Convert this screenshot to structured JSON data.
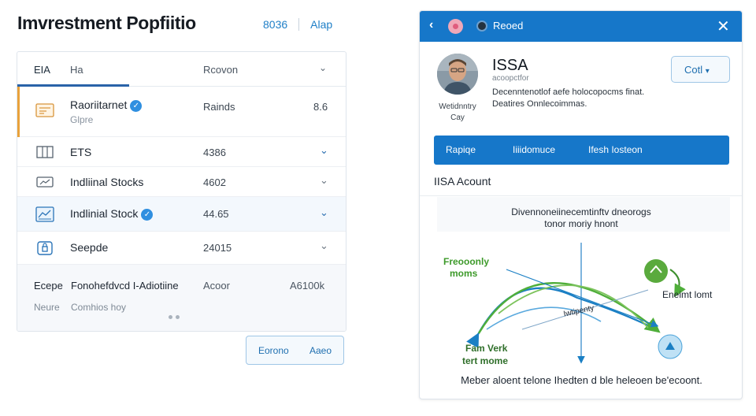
{
  "header": {
    "title": "Imvrestment Popfiitio",
    "link_left": "8036",
    "link_right": "Alap"
  },
  "table": {
    "columns": [
      "EIA",
      "Ha",
      "Rcovon"
    ],
    "rows": [
      {
        "name": "Raoriitarnet",
        "sub": "Glpre",
        "value": "Rainds",
        "value_right": "8.6",
        "verified": true,
        "icon": "card-icon"
      },
      {
        "name": "ETS",
        "value": "4386",
        "icon": "bar-chart-icon"
      },
      {
        "name": "Indliinal Stocks",
        "value": "4602",
        "icon": "screen-icon"
      },
      {
        "name": "Indlinial Stock",
        "value": "44.65",
        "verified": true,
        "icon": "chart-grid-icon"
      },
      {
        "name": "Seepde",
        "value": "24015",
        "icon": "lock-icon"
      }
    ],
    "footer": {
      "label": "Ecepe",
      "description": "Fonohefdvcd I-Adiotiine",
      "col3": "Acoor",
      "amount": "A6100k",
      "sublabel": "Neure",
      "note": "Comhios hoy"
    }
  },
  "buttons": {
    "primary": "Eorono",
    "secondary": "Aaeo"
  },
  "modal": {
    "title": "Reoed",
    "account": {
      "name": "ISSA",
      "subtitle": "acoopctfor",
      "description": "Decenntenotlof aefe holocopocms finat. Deatires Onnlecoimmas.",
      "caption_line1": "Wetidnntry",
      "caption_line2": "Cay",
      "cart_label": "Cotl"
    },
    "tabs": [
      "Rapiqe",
      "Iiiidomuce",
      "Ifesh Iosteon"
    ],
    "section_title": "IISA Acount",
    "diagram": {
      "caption_line1": "Divennoneiinecemtinftv dneorogs",
      "caption_line2": "tonor moriy hnont",
      "label_left_top": [
        "Freooonly",
        "moms"
      ],
      "label_left_bottom": [
        "Fam Verk",
        "tert mome"
      ],
      "label_center": "Iwtipenty",
      "label_right": "Eneimt lomt"
    },
    "footer_text": "Meber aloent telone Ihedten d ble heleoen be'ecoont."
  },
  "colors": {
    "brand_blue": "#1677c9",
    "green": "#4fae3a",
    "link_blue": "#1f7fc7",
    "accent_orange": "#e9a23b"
  }
}
